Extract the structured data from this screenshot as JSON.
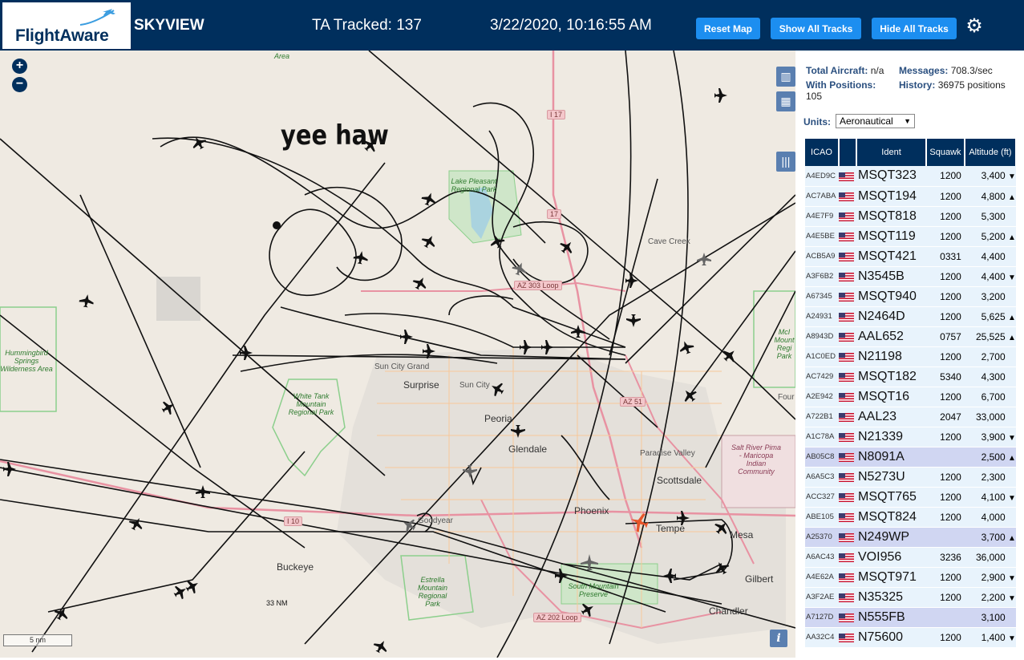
{
  "header": {
    "logo_text": "FlightAware",
    "app_name": "SKYVIEW",
    "tracked": "TA Tracked: 137",
    "clock": "3/22/2020, 10:16:55 AM",
    "buttons": {
      "reset": "Reset Map",
      "show_all": "Show All Tracks",
      "hide_all": "Hide All Tracks"
    },
    "gear_icon": "gear-icon"
  },
  "map": {
    "annotation": "yee haw",
    "zoom_in": "+",
    "zoom_out": "−",
    "scale_label": "5 nm",
    "distance_label": "33 NM",
    "info": "i",
    "cities": {
      "sun_city_grand": "Sun City Grand",
      "surprise": "Surprise",
      "sun_city": "Sun City",
      "peoria": "Peoria",
      "glendale": "Glendale",
      "paradise_valley": "Paradise Valley",
      "scottsdale": "Scottsdale",
      "phoenix": "Phoenix",
      "tempe": "Tempe",
      "mesa": "Mesa",
      "gilbert": "Gilbert",
      "chandler": "Chandler",
      "buckeye": "Buckeye",
      "goodyear": "Goodyear",
      "cave_creek": "Cave Creek",
      "four": "Four"
    },
    "parks": {
      "hummingbird": "Hummingbird Springs Wilderness Area",
      "white_tank": "White Tank Mountain Regional Park",
      "lake_pleasant": "Lake Pleasant Regional Park",
      "estrella": "Estrella Mountain Regional Park",
      "south_mountain": "South Mountain Preserve",
      "salt_river": "Salt River Pima - Maricopa Indian Community",
      "mcdowell": "McI Mount Regi Park",
      "area_top": "Area"
    },
    "shields": {
      "i17": "I 17",
      "hwy17": "17",
      "az303": "AZ 303 Loop",
      "az51": "AZ 51",
      "i10": "I 10",
      "az202": "AZ 202 Loop"
    }
  },
  "sidebar": {
    "total_aircraft_label": "Total Aircraft:",
    "total_aircraft": "n/a",
    "messages_label": "Messages:",
    "messages": "708.3/sec",
    "with_positions_label": "With Positions:",
    "with_positions": "105",
    "history_label": "History:",
    "history": "36975 positions",
    "units_label": "Units:",
    "units_value": "Aeronautical",
    "columns": [
      "ICAO",
      "",
      "Ident",
      "Squawk",
      "Altitude (ft)"
    ],
    "rows": [
      {
        "icao": "A4ED9C",
        "ident": "MSQT323",
        "squawk": "1200",
        "alt": "3,400",
        "trend": "▼",
        "sel": false
      },
      {
        "icao": "AC7ABA",
        "ident": "MSQT194",
        "squawk": "1200",
        "alt": "4,800",
        "trend": "▲",
        "sel": false
      },
      {
        "icao": "A4E7F9",
        "ident": "MSQT818",
        "squawk": "1200",
        "alt": "5,300",
        "trend": "",
        "sel": false
      },
      {
        "icao": "A4E5BE",
        "ident": "MSQT119",
        "squawk": "1200",
        "alt": "5,200",
        "trend": "▲",
        "sel": false
      },
      {
        "icao": "ACB5A9",
        "ident": "MSQT421",
        "squawk": "0331",
        "alt": "4,400",
        "trend": "",
        "sel": false
      },
      {
        "icao": "A3F6B2",
        "ident": "N3545B",
        "squawk": "1200",
        "alt": "4,400",
        "trend": "▼",
        "sel": false
      },
      {
        "icao": "A67345",
        "ident": "MSQT940",
        "squawk": "1200",
        "alt": "3,200",
        "trend": "",
        "sel": false
      },
      {
        "icao": "A24931",
        "ident": "N2464D",
        "squawk": "1200",
        "alt": "5,625",
        "trend": "▲",
        "sel": false
      },
      {
        "icao": "A8943D",
        "ident": "AAL652",
        "squawk": "0757",
        "alt": "25,525",
        "trend": "▲",
        "sel": false
      },
      {
        "icao": "A1C0ED",
        "ident": "N21198",
        "squawk": "1200",
        "alt": "2,700",
        "trend": "",
        "sel": false
      },
      {
        "icao": "AC7429",
        "ident": "MSQT182",
        "squawk": "5340",
        "alt": "4,300",
        "trend": "",
        "sel": false
      },
      {
        "icao": "A2E942",
        "ident": "MSQT16",
        "squawk": "1200",
        "alt": "6,700",
        "trend": "",
        "sel": false
      },
      {
        "icao": "A722B1",
        "ident": "AAL23",
        "squawk": "2047",
        "alt": "33,000",
        "trend": "",
        "sel": false
      },
      {
        "icao": "A1C78A",
        "ident": "N21339",
        "squawk": "1200",
        "alt": "3,900",
        "trend": "▼",
        "sel": false
      },
      {
        "icao": "AB05C8",
        "ident": "N8091A",
        "squawk": "",
        "alt": "2,500",
        "trend": "▲",
        "sel": true
      },
      {
        "icao": "A6A5C3",
        "ident": "N5273U",
        "squawk": "1200",
        "alt": "2,300",
        "trend": "",
        "sel": false
      },
      {
        "icao": "ACC327",
        "ident": "MSQT765",
        "squawk": "1200",
        "alt": "4,100",
        "trend": "▼",
        "sel": false
      },
      {
        "icao": "ABE105",
        "ident": "MSQT824",
        "squawk": "1200",
        "alt": "4,000",
        "trend": "",
        "sel": false
      },
      {
        "icao": "A25370",
        "ident": "N249WP",
        "squawk": "",
        "alt": "3,700",
        "trend": "▲",
        "sel": true
      },
      {
        "icao": "A6AC43",
        "ident": "VOI956",
        "squawk": "3236",
        "alt": "36,000",
        "trend": "",
        "sel": false
      },
      {
        "icao": "A4E62A",
        "ident": "MSQT971",
        "squawk": "1200",
        "alt": "2,900",
        "trend": "▼",
        "sel": false
      },
      {
        "icao": "A3F2AE",
        "ident": "N35325",
        "squawk": "1200",
        "alt": "2,200",
        "trend": "▼",
        "sel": false
      },
      {
        "icao": "A7127D",
        "ident": "N555FB",
        "squawk": "",
        "alt": "3,100",
        "trend": "",
        "sel": true
      },
      {
        "icao": "AA32C4",
        "ident": "N75600",
        "squawk": "1200",
        "alt": "1,400",
        "trend": "▼",
        "sel": false
      }
    ]
  },
  "colors": {
    "header_bg": "#002f5d",
    "button": "#1c8ef0",
    "row": "#e8f3fc",
    "row_selected": "#d0d6f2",
    "selected_plane": "#e8542a"
  }
}
